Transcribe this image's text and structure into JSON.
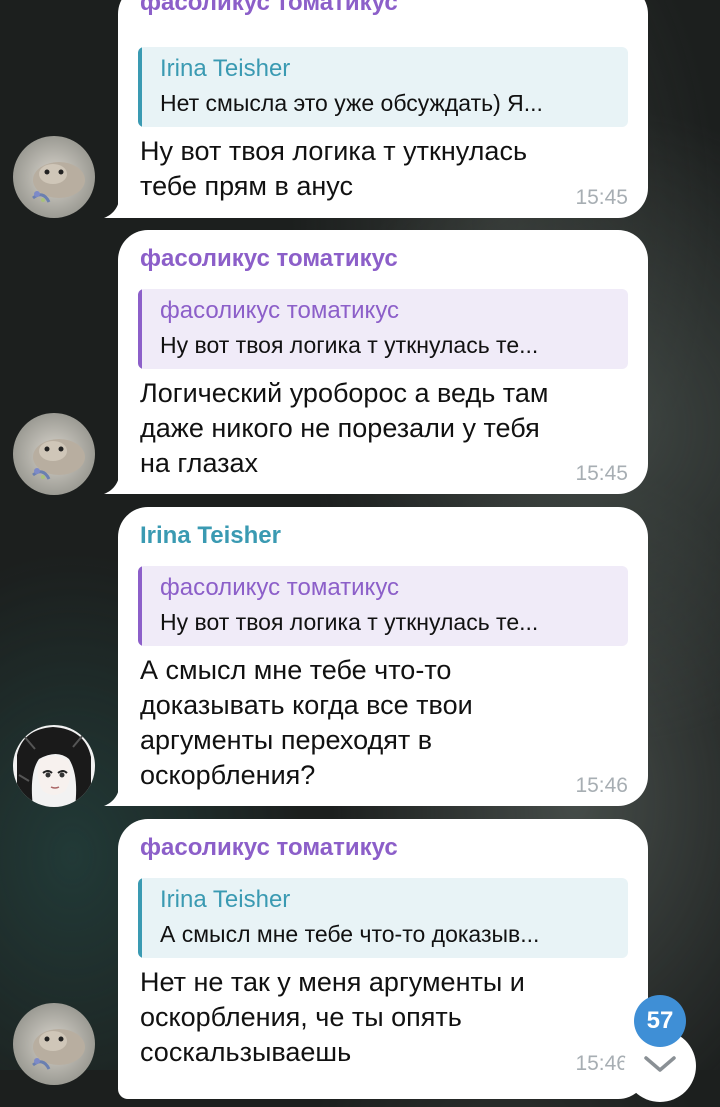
{
  "messages": [
    {
      "sender": "фасоликус томатикус",
      "quote_name": "Irina Teisher",
      "quote_text": "Нет смысла это уже обсуждать) Я...",
      "text": "Ну вот твоя логика т уткнулась тебе прям в анус",
      "time": "15:45"
    },
    {
      "sender": "фасоликус томатикус",
      "quote_name": "фасоликус томатикус",
      "quote_text": "Ну вот твоя логика т уткнулась те...",
      "text": "Логический уроборос а ведь там даже никого не порезали у тебя на глазах",
      "time": "15:45"
    },
    {
      "sender": "Irina Teisher",
      "quote_name": "фасоликус томатикус",
      "quote_text": "Ну вот твоя логика т уткнулась те...",
      "text": "А смысл мне тебе что-то доказывать когда все твои аргументы переходят в оскорбления?",
      "time": "15:46"
    },
    {
      "sender": "фасоликус томатикус",
      "quote_name": "Irina Teisher",
      "quote_text": "А смысл мне тебе что-то доказыв...",
      "text": "Нет не так у меня аргументы и оскорбления, че ты опять соскальзываешь",
      "time": "15:46"
    }
  ],
  "unread_badge": "57",
  "colors": {
    "purple_name": "#8c5fc9",
    "teal_name": "#3a9ab2",
    "badge": "#3f8fd6"
  },
  "icons": {
    "scroll_down": "chevron-down-icon",
    "avatar_1": "hamster-avatar",
    "avatar_2": "anime-avatar"
  }
}
